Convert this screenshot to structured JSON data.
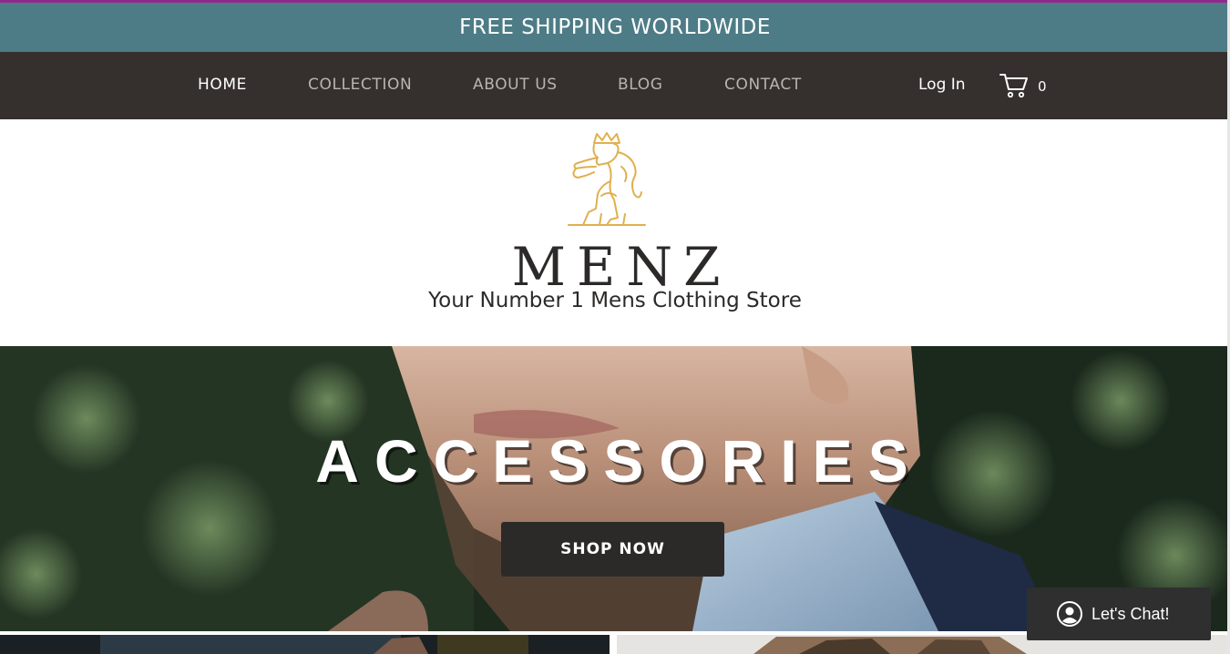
{
  "colors": {
    "accent_line": "#8e2a8e",
    "promo_bg": "#4d7c86",
    "nav_bg": "#35302e",
    "nav_active": "#ffffff",
    "nav_inactive": "#b9b4b0",
    "logo_gold": "#e0b04f",
    "logo_text": "#2c2a29",
    "button_dark": "#2c2a29"
  },
  "promo": {
    "text": "FREE SHIPPING WORLDWIDE"
  },
  "nav": {
    "items": [
      {
        "label": "HOME",
        "active": true
      },
      {
        "label": "COLLECTION",
        "active": false
      },
      {
        "label": "ABOUT US",
        "active": false
      },
      {
        "label": "BLOG",
        "active": false
      },
      {
        "label": "CONTACT",
        "active": false
      }
    ],
    "login_label": "Log In",
    "cart_icon": "cart-icon",
    "cart_count": "0"
  },
  "brand": {
    "logo_icon": "crowned-lion-icon",
    "name": "MENZ",
    "tagline": "Your Number 1 Mens Clothing Store"
  },
  "hero": {
    "title": "ACCESSORIES",
    "button_label": "SHOP NOW"
  },
  "chat": {
    "icon": "user-avatar-icon",
    "label": "Let's Chat!"
  }
}
